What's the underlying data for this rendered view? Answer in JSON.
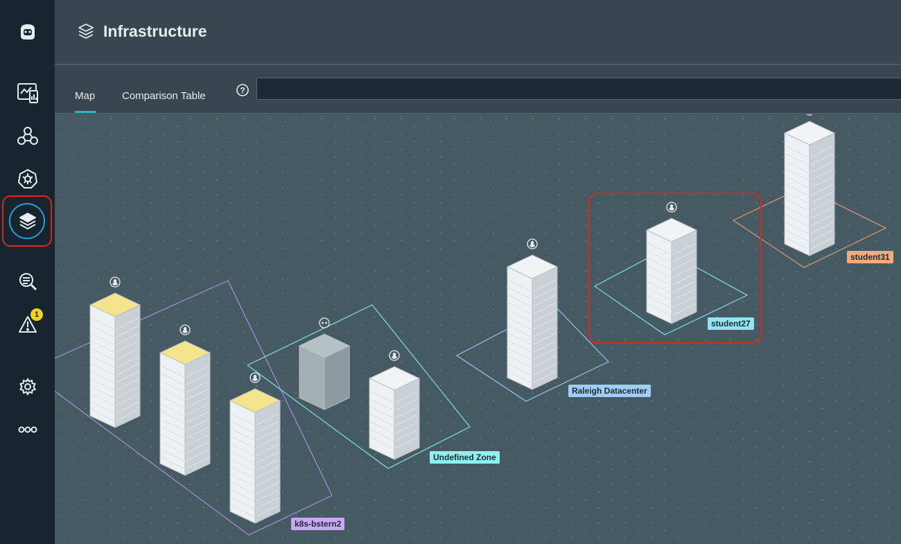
{
  "header": {
    "title": "Infrastructure"
  },
  "tabs": [
    {
      "label": "Map"
    },
    {
      "label": "Comparison Table"
    }
  ],
  "filter": {
    "value": "",
    "placeholder": ""
  },
  "sidebar": {
    "items": [
      {
        "icon": "logo-icon"
      },
      {
        "icon": "websites-dashboard-icon"
      },
      {
        "icon": "applications-icon"
      },
      {
        "icon": "kubernetes-icon"
      },
      {
        "icon": "infrastructure-icon",
        "active": true
      },
      {
        "icon": "analytics-search-icon"
      },
      {
        "icon": "events-alert-icon",
        "badge": "1"
      },
      {
        "icon": "settings-gear-icon"
      },
      {
        "icon": "more-icon"
      }
    ]
  },
  "zones": [
    {
      "name": "k8s-bstern2",
      "color": "#c9a7f2"
    },
    {
      "name": "Undefined Zone",
      "color": "#8ff0ee"
    },
    {
      "name": "Raleigh Datacenter",
      "color": "#9fcdf5"
    },
    {
      "name": "student27",
      "color": "#8fe6f2",
      "selected": true
    },
    {
      "name": "student31",
      "color": "#f2ab7e"
    }
  ],
  "colors": {
    "accent": "#2bb5c2",
    "selection": "#e0281a",
    "sidebar": "#17252e",
    "map_bg": "#465a63",
    "warning_badge": "#f2d026"
  }
}
